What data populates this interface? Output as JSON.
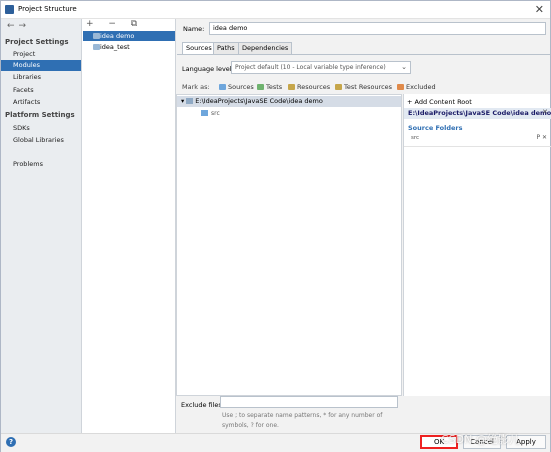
{
  "window": {
    "title": "Project Structure",
    "close_glyph": "✕",
    "nav_arrows": "←→"
  },
  "leftnav": {
    "project_settings_header": "Project Settings",
    "project_settings_items": [
      "Project",
      "Modules",
      "Libraries",
      "Facets",
      "Artifacts"
    ],
    "selected_item": "Modules",
    "platform_settings_header": "Platform Settings",
    "platform_settings_items": [
      "SDKs",
      "Global Libraries"
    ],
    "problems": "Problems"
  },
  "modules": {
    "toolbar": "+ − ⧉",
    "items": [
      "idea demo",
      "idea_test"
    ],
    "selected": "idea demo"
  },
  "module": {
    "name_label": "Name:",
    "name_value": "idea demo",
    "tabs": [
      "Sources",
      "Paths",
      "Dependencies"
    ],
    "selected_tab": "Sources",
    "language_level_label": "Language level:",
    "language_level_value": "Project default (10 - Local variable type inference)",
    "mark_as_label": "Mark as:",
    "mark_options": [
      {
        "label": "Sources",
        "color": "#6ea6dc"
      },
      {
        "label": "Tests",
        "color": "#6fb36f"
      },
      {
        "label": "Resources",
        "color": "#c6a64a"
      },
      {
        "label": "Test Resources",
        "color": "#c6a64a"
      },
      {
        "label": "Excluded",
        "color": "#e08a4a"
      }
    ]
  },
  "tree": {
    "root": "E:\\IdeaProjects\\JavaSE Code\\idea demo",
    "child": "src"
  },
  "content_root": {
    "add_label": "+ Add Content Root",
    "path": "E:\\IdeaProjects\\JavaSE Code\\idea demo",
    "source_folders_label": "Source Folders",
    "source_folder": "src",
    "source_folder_actions": "P ✕"
  },
  "exclude": {
    "label": "Exclude files:",
    "value": "",
    "hint": "Use ; to separate name patterns, * for any number of symbols, ? for one."
  },
  "buttons": {
    "ok": "OK",
    "cancel": "Cancel",
    "apply": "Apply",
    "help": "?"
  },
  "watermark": "CSDN @绝影儿",
  "colors": {
    "selection": "#2f6fb3",
    "highlight_box": "#ee2222"
  }
}
